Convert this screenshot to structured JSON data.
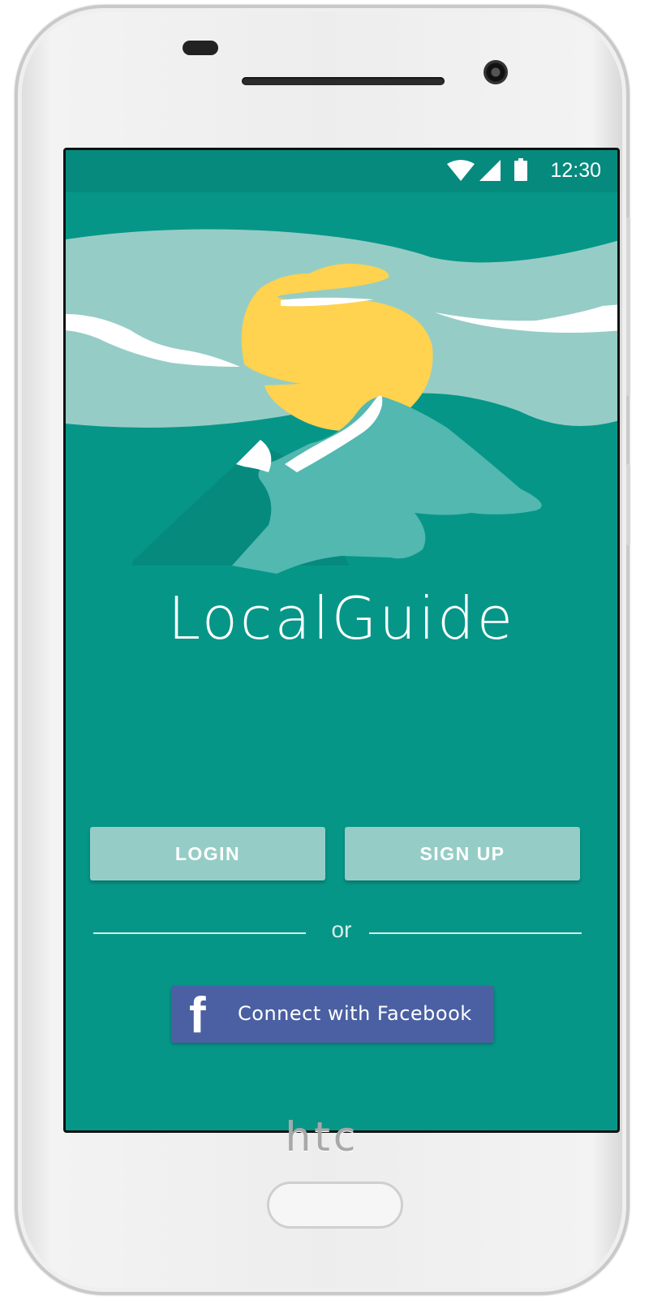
{
  "device": {
    "brand": "htc"
  },
  "status_bar": {
    "time": "12:30",
    "icons": [
      "wifi-icon",
      "signal-icon",
      "battery-icon"
    ]
  },
  "app": {
    "title": "LocalGuide"
  },
  "auth": {
    "login_label": "LOGIN",
    "signup_label": "SIGN UP",
    "or_label": "or",
    "facebook_label": "Connect with Facebook",
    "facebook_icon": "facebook-icon"
  },
  "colors": {
    "primary": "#069688",
    "status_bar": "#068a7e",
    "button": "#95cdc6",
    "facebook": "#4a60a2",
    "sun": "#ffd24f"
  }
}
